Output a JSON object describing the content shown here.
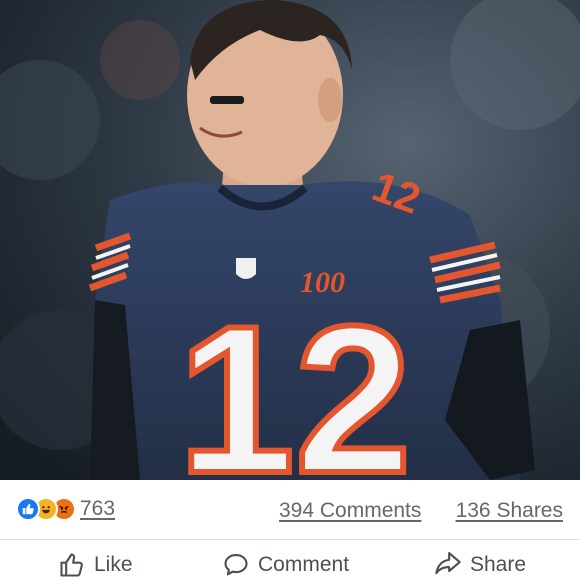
{
  "post": {
    "photo": {
      "icon": "photo-football-player"
    },
    "reactions": {
      "icons": [
        "like-reaction-icon",
        "haha-reaction-icon",
        "angry-reaction-icon"
      ],
      "count": "763"
    },
    "comments_label": "394 Comments",
    "shares_label": "136 Shares",
    "actions": {
      "like_label": "Like",
      "comment_label": "Comment",
      "share_label": "Share"
    }
  },
  "colors": {
    "like_blue": "#1877f2",
    "haha_yellow": "#f7b125",
    "angry_orange": "#e9710f",
    "text_secondary": "#65676b",
    "jersey_navy": "#2b3a55",
    "jersey_orange": "#e4572e"
  }
}
